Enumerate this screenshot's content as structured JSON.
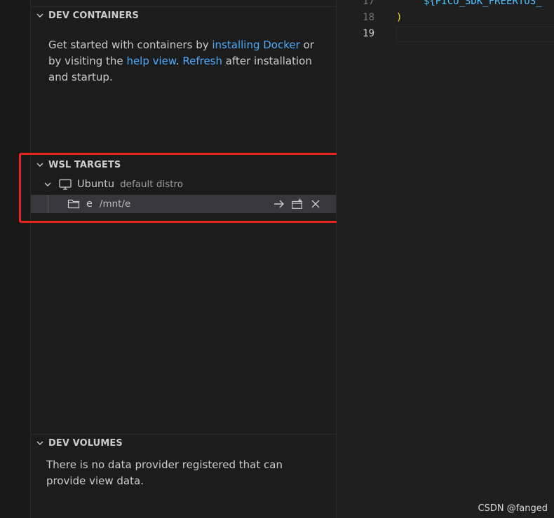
{
  "sections": {
    "dev_containers": {
      "title": "DEV CONTAINERS",
      "msg_part1": "Get started with containers by ",
      "link_install": "installing Docker",
      "msg_part2": " or by visiting the ",
      "link_help": "help view",
      "msg_part3": ". ",
      "link_refresh": "Refresh",
      "msg_part4": " after installation and startup."
    },
    "wsl_targets": {
      "title": "WSL TARGETS",
      "distro_name": "Ubuntu",
      "distro_desc": "default distro",
      "folder_name": "e",
      "folder_path": "/mnt/e",
      "actions": [
        "arrow-right-icon",
        "new-window-icon",
        "close-icon"
      ]
    },
    "dev_volumes": {
      "title": "DEV VOLUMES",
      "message": "There is no data provider registered that can provide view data."
    }
  },
  "editor": {
    "lines": [
      {
        "number": "17",
        "text": "${PICO_SDK_FREERTOS_"
      },
      {
        "number": "18",
        "text": ")"
      },
      {
        "number": "19",
        "text": ""
      }
    ],
    "colors": {
      "code_var": "#4fc1ff",
      "paren": "#ffd700"
    }
  },
  "watermark": "CSDN @fanged",
  "colors": {
    "highlight_box": "#e8241f",
    "link": "#4daafc"
  }
}
